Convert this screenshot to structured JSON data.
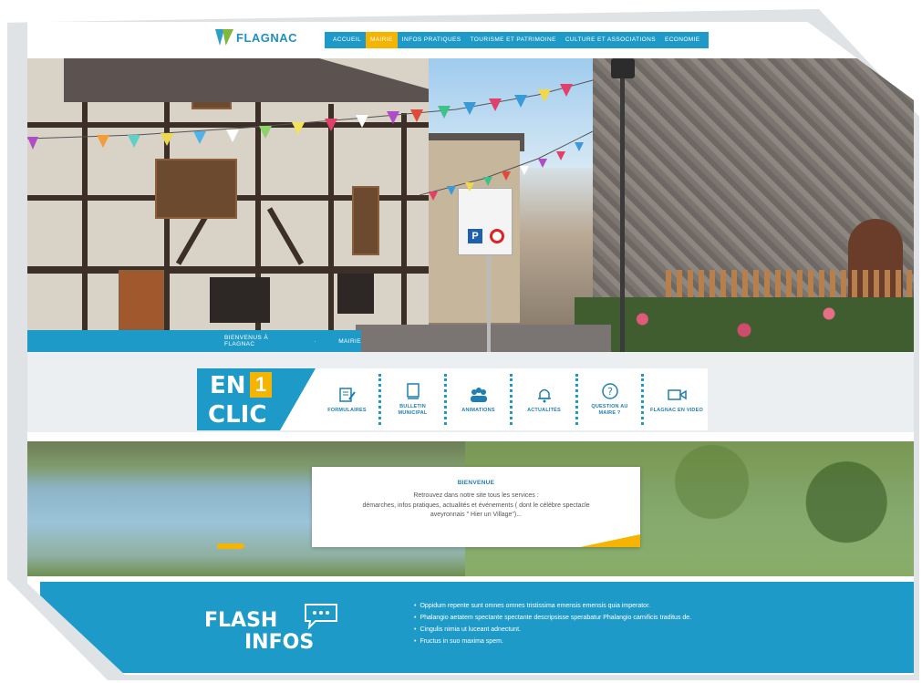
{
  "logo": {
    "text": "FLAGNAC"
  },
  "nav": {
    "items": [
      "ACCUEIL",
      "MAIRIE",
      "INFOS PRATIQUES",
      "TOURISME ET PATRIMOINE",
      "CULTURE ET ASSOCIATIONS",
      "ECONOMIE"
    ],
    "active": "MAIRIE"
  },
  "breadcrumb": {
    "home": "BIENVENUS À FLAGNAC",
    "current": "MAIRIE"
  },
  "en1clic": {
    "en": "EN",
    "one": "1",
    "clic": "CLIC",
    "items": [
      {
        "label": "FORMULAIRES",
        "icon": "form-icon"
      },
      {
        "label": "BULLETIN MUNICIPAL",
        "icon": "book-icon"
      },
      {
        "label": "ANIMATIONS",
        "icon": "people-icon"
      },
      {
        "label": "ACTUALITÉS",
        "icon": "bell-icon"
      },
      {
        "label": "QUESTION AU MAIRE ?",
        "icon": "question-icon"
      },
      {
        "label": "FLAGNAC EN VIDEO",
        "icon": "video-icon"
      }
    ]
  },
  "welcome": {
    "title": "BIENVENUE",
    "line1": "Retrouvez dans notre site tous les services :",
    "line2": "démarches, infos pratiques, actualités et événements ( dont le célèbre spectacle",
    "line3": "aveyronnais \" Hier un Village\")..."
  },
  "flash": {
    "title1": "FLASH",
    "title2": "INFOS",
    "items": [
      "Oppidum repente sunt omnes omnes tristissima emensis emensis quia imperator.",
      "Phalangio aetatem spectante spectante descripsisse sperabatur Phalangio carnificis traditus de.",
      "Cingulis nimia ut luceant adnectunt.",
      "Fructus in suo maxima spem."
    ]
  },
  "colors": {
    "primary": "#1e9ac8",
    "accent": "#f4b400",
    "text_blue": "#1e7fb0"
  }
}
